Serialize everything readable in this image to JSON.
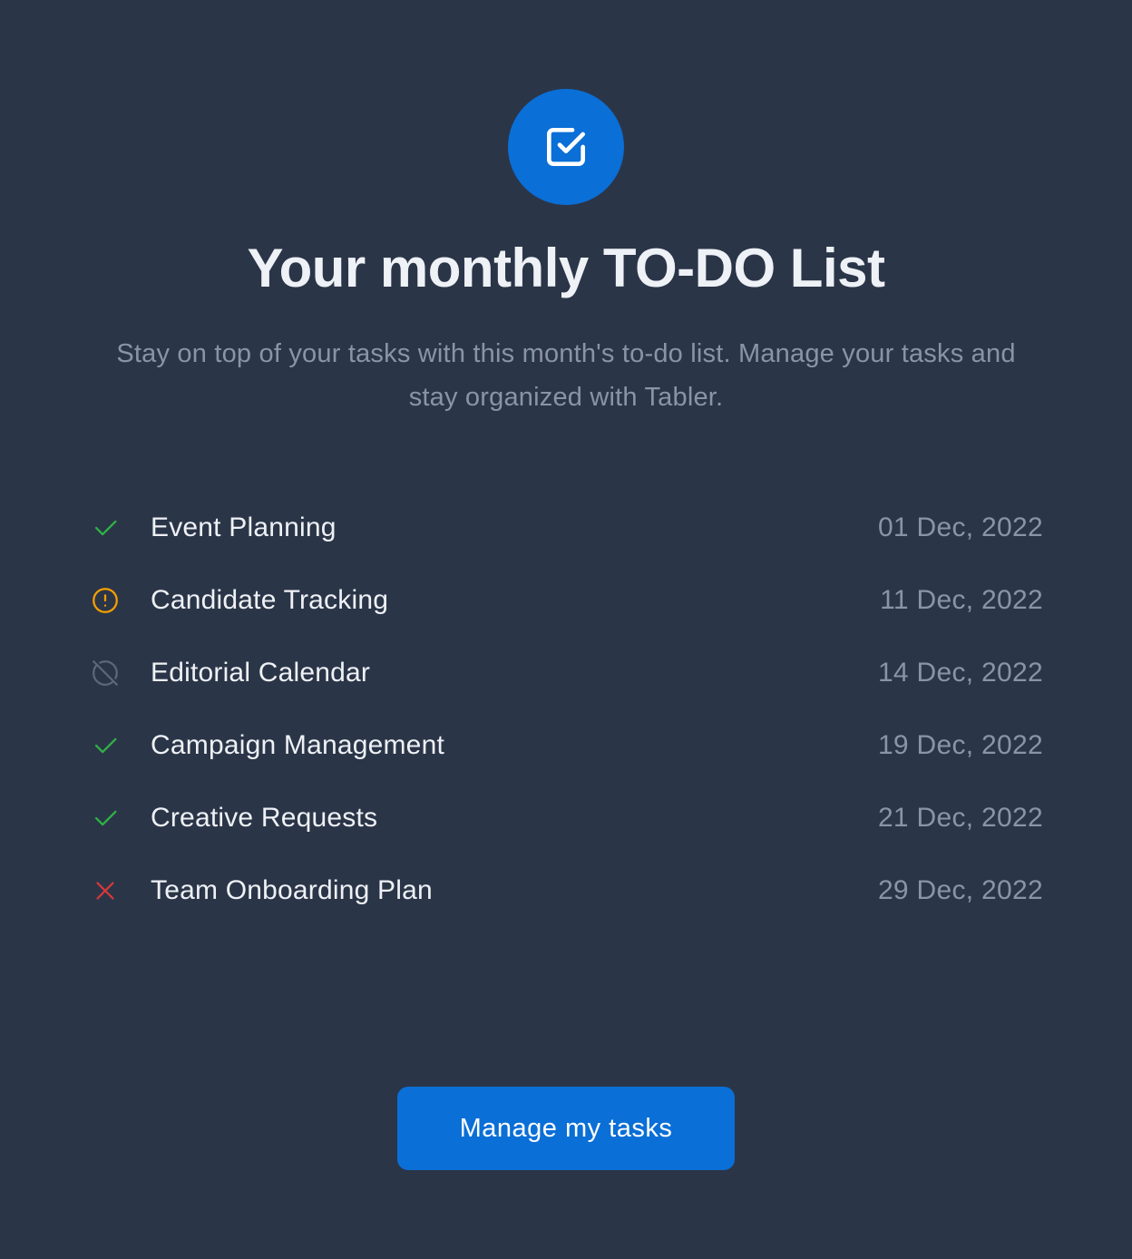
{
  "hero": {
    "icon": "checkbox-icon",
    "title": "Your monthly TO-DO List",
    "subtitle": "Stay on top of your tasks with this month's to-do list. Manage your tasks and stay organized with Tabler."
  },
  "tasks": [
    {
      "name": "Event Planning",
      "date": "01 Dec, 2022",
      "status": "done",
      "icon": "check-icon",
      "color": "#2fb344"
    },
    {
      "name": "Candidate Tracking",
      "date": "11 Dec, 2022",
      "status": "warning",
      "icon": "alert-circle-icon",
      "color": "#f59f00"
    },
    {
      "name": "Editorial Calendar",
      "date": "14 Dec, 2022",
      "status": "disabled",
      "icon": "circle-off-icon",
      "color": "#5c677a"
    },
    {
      "name": "Campaign Management",
      "date": "19 Dec, 2022",
      "status": "done",
      "icon": "check-icon",
      "color": "#2fb344"
    },
    {
      "name": "Creative Requests",
      "date": "21 Dec, 2022",
      "status": "done",
      "icon": "check-icon",
      "color": "#2fb344"
    },
    {
      "name": "Team Onboarding Plan",
      "date": "29 Dec, 2022",
      "status": "failed",
      "icon": "x-icon",
      "color": "#d63939"
    }
  ],
  "actions": {
    "manage_label": "Manage my tasks"
  },
  "colors": {
    "background": "#2b3548",
    "accent": "#0a6fd6",
    "text": "#eef1f5",
    "muted": "#8a94a6"
  }
}
